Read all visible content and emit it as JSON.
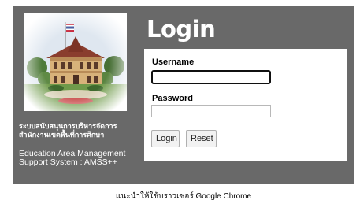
{
  "header": {
    "title": "Login"
  },
  "brand": {
    "image": "school-building-photo",
    "org_thai_line1": "ระบบสนับสนุนการบริหารจัดการ",
    "org_thai_line2": "สำนักงานเขตพื้นที่การศึกษา",
    "system_line1": "Education Area Management",
    "system_line2": "Support System : AMSS++"
  },
  "form": {
    "username_label": "Username",
    "username_value": "",
    "password_label": "Password",
    "password_value": "",
    "login_button": "Login",
    "reset_button": "Reset"
  },
  "footer": {
    "browser_note": "แนะนำให้ใช้บราวเซอร์ Google Chrome"
  },
  "colors": {
    "panel_background": "#696969",
    "form_background": "#ffffff",
    "title_text": "#ffffff"
  }
}
